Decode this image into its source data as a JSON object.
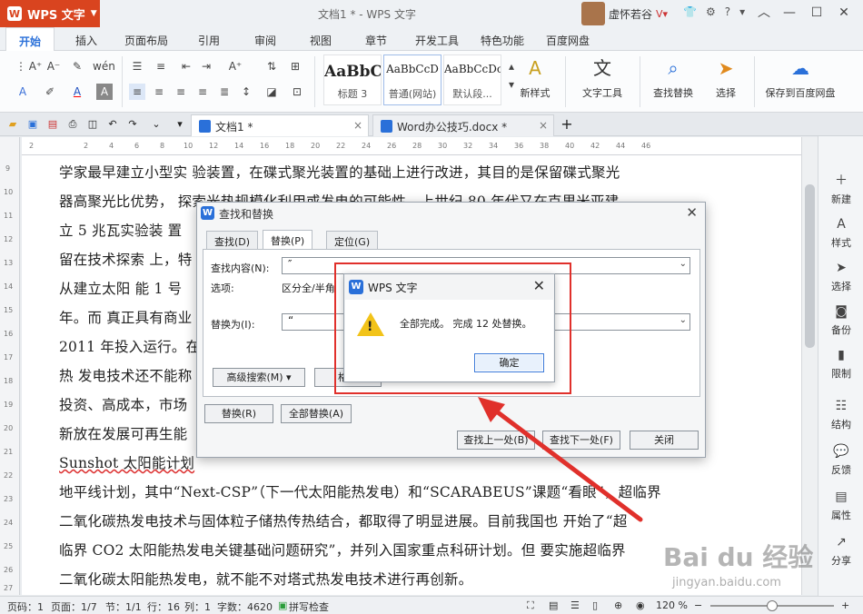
{
  "app": {
    "name": "WPS 文字",
    "window_title": "文档1 * - WPS 文字",
    "user_name": "虚怀若谷"
  },
  "menu_tabs": [
    "开始",
    "插入",
    "页面布局",
    "引用",
    "审阅",
    "视图",
    "章节",
    "开发工具",
    "特色功能",
    "百度网盘"
  ],
  "ribbon": {
    "styles": [
      {
        "sample": "AaBbC",
        "name": "标题 3"
      },
      {
        "sample": "AaBbCcD",
        "name": "普通(网站)"
      },
      {
        "sample": "AaBbCcDc",
        "name": "默认段..."
      }
    ],
    "tools": [
      "新样式",
      "文字工具",
      "查找替换",
      "选择",
      "保存到百度网盘"
    ]
  },
  "doc_tabs": [
    {
      "label": "文档1 *",
      "active": true
    },
    {
      "label": "Word办公技巧.docx *",
      "active": false
    }
  ],
  "ruler_numbers": [
    "2",
    "2",
    "4",
    "6",
    "8",
    "10",
    "12",
    "14",
    "16",
    "18",
    "20",
    "22",
    "24",
    "26",
    "28",
    "30",
    "32",
    "34",
    "36",
    "38",
    "40",
    "42",
    "44",
    "46"
  ],
  "vruler_numbers": [
    "9",
    "10",
    "11",
    "12",
    "13",
    "14",
    "15",
    "16",
    "17",
    "18",
    "19",
    "20",
    "21",
    "22",
    "23",
    "24",
    "25",
    "26",
    "27"
  ],
  "document_lines": [
    "学家最早建立小型实  验装置，在碟式聚光装置的基础上进行改进，其目的是保留碟式聚光",
    "器高聚光比优势，  探索光热规模化利用或发电的可能性。上世纪  80  年代又在克里米亚建",
    "立  5  兆瓦实验装  置",
    "留在技术探索  上，特",
    "从建立太阳  能  1  号",
    "年。而  真正具有商业",
    "2011  年投入运行。在",
    "热  发电技术还不能称",
    "投资、高成本，市场",
    "新放在发展可再生能",
    "Sunshot  太阳能计划",
    "地平线计划，其中“Next-CSP”（下一代太阳能热发电）和“SCARABEUS”课题“看眼”，超临界",
    "二氧化碳热发电技术与固体粒子储热传热结合，都取得了明显进展。目前我国也  开始了“超",
    "临界  CO2  太阳能热发电关键基础问题研究”，并列入国家重点科研计划。但  要实施超临界",
    "二氧化碳太阳能热发电，就不能不对塔式热发电技术进行再创新。"
  ],
  "sidebar_items": [
    "新建",
    "样式",
    "选择",
    "备份",
    "限制",
    "结构",
    "反馈",
    "属性",
    "分享"
  ],
  "status": {
    "page_no": "页码：1",
    "page": "页面：1/7",
    "section": "节：1/1",
    "row": "行：16",
    "col": "列：1",
    "word_count": "字数：4620",
    "spell_check": "拼写检查",
    "zoom": "120 %"
  },
  "find_replace_dialog": {
    "title": "查找和替换",
    "tabs": [
      "查找(D)",
      "替换(P)",
      "定位(G)"
    ],
    "find_label": "查找内容(N):",
    "find_value": "″",
    "options_label": "选项:",
    "options_value": "区分全/半角",
    "replace_label": "替换为(I):",
    "replace_value": "“",
    "advanced_search": "高级搜索(M) ▾",
    "format_btn": "格式",
    "replace_btn": "替换(R)",
    "replace_all_btn": "全部替换(A)",
    "find_prev_btn": "查找上一处(B)",
    "find_next_btn": "查找下一处(F)",
    "close_btn": "关闭"
  },
  "message_box": {
    "title": "WPS 文字",
    "message": "全部完成。  完成  12  处替换。",
    "ok_label": "确定"
  },
  "watermark": {
    "brand": "Bai du 经验",
    "url": "jingyan.baidu.com"
  },
  "colors": {
    "accent": "#2a70d9",
    "app_orange": "#d9441f",
    "annotation_red": "#e0302b"
  }
}
